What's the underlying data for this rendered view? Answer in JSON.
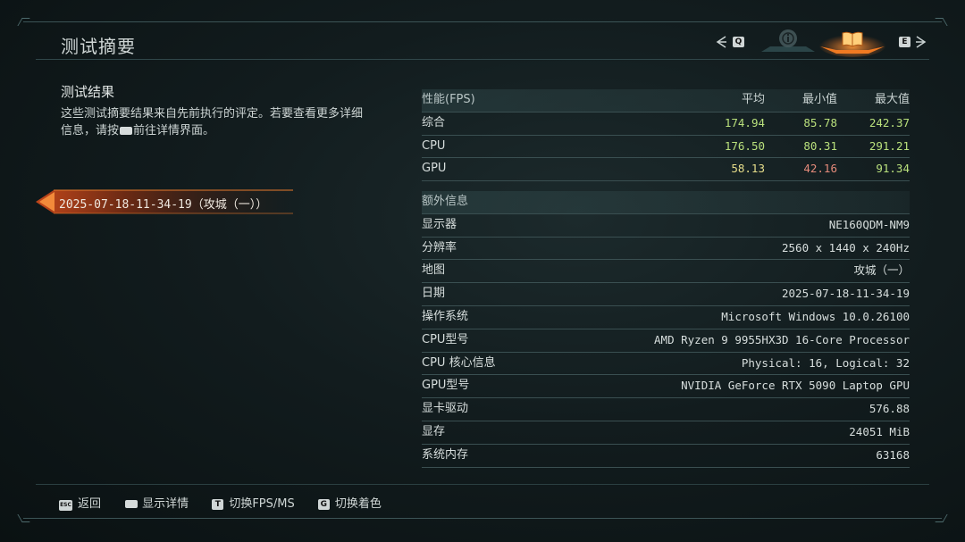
{
  "window": {
    "title": "测试摘要"
  },
  "nav": {
    "left_key": "Q",
    "right_key": "E",
    "tabs": [
      {
        "name": "info-tab",
        "icon": "info-icon"
      },
      {
        "name": "book-tab",
        "icon": "book-icon",
        "active": true
      }
    ]
  },
  "summary": {
    "heading": "测试结果",
    "desc_part1": "这些测试摘要结果来自先前执行的评定。若要查看更多详细信息，请按",
    "desc_part2": "前往详情界面。"
  },
  "runs": [
    {
      "label": "2025-07-18-11-34-19（攻城（一））",
      "selected": true
    }
  ],
  "performance": {
    "header": {
      "label": "性能(FPS)",
      "avg": "平均",
      "min": "最小值",
      "max": "最大值"
    },
    "rows": [
      {
        "label": "综合",
        "avg": "174.94",
        "min": "85.78",
        "max": "242.37",
        "avg_color": "#b9e07c",
        "min_color": "#b9e07c",
        "max_color": "#b9e07c"
      },
      {
        "label": "CPU",
        "avg": "176.50",
        "min": "80.31",
        "max": "291.21",
        "avg_color": "#b9e07c",
        "min_color": "#b9e07c",
        "max_color": "#b9e07c"
      },
      {
        "label": "GPU",
        "avg": "58.13",
        "min": "42.16",
        "max": "91.34",
        "avg_color": "#e6dd8a",
        "min_color": "#e48a7a",
        "max_color": "#b9e07c"
      }
    ]
  },
  "extra": {
    "header": "额外信息",
    "rows": [
      {
        "label": "显示器",
        "value": "NE160QDM-NM9"
      },
      {
        "label": "分辨率",
        "value": "2560 x 1440 x 240Hz"
      },
      {
        "label": "地图",
        "value": "攻城（一）"
      },
      {
        "label": "日期",
        "value": "2025-07-18-11-34-19"
      },
      {
        "label": "操作系统",
        "value": "Microsoft Windows 10.0.26100"
      },
      {
        "label": "CPU型号",
        "value": "AMD Ryzen 9 9955HX3D 16-Core Processor"
      },
      {
        "label": "CPU 核心信息",
        "value": "Physical: 16, Logical: 32"
      },
      {
        "label": "GPU型号",
        "value": "NVIDIA GeForce RTX 5090 Laptop GPU"
      },
      {
        "label": "显卡驱动",
        "value": "576.88"
      },
      {
        "label": "显存",
        "value": "24051 MiB"
      },
      {
        "label": "系统内存",
        "value": "63168"
      }
    ]
  },
  "footer": {
    "back": {
      "key": "ESC",
      "label": "返回"
    },
    "details": {
      "label": "显示详情"
    },
    "toggle_fps": {
      "key": "T",
      "label": "切换FPS/MS"
    },
    "toggle_color": {
      "key": "G",
      "label": "切换着色"
    }
  },
  "colors": {
    "accent": "#e86a1c",
    "good": "#b9e07c",
    "warn": "#e6dd8a",
    "bad": "#e48a7a"
  }
}
